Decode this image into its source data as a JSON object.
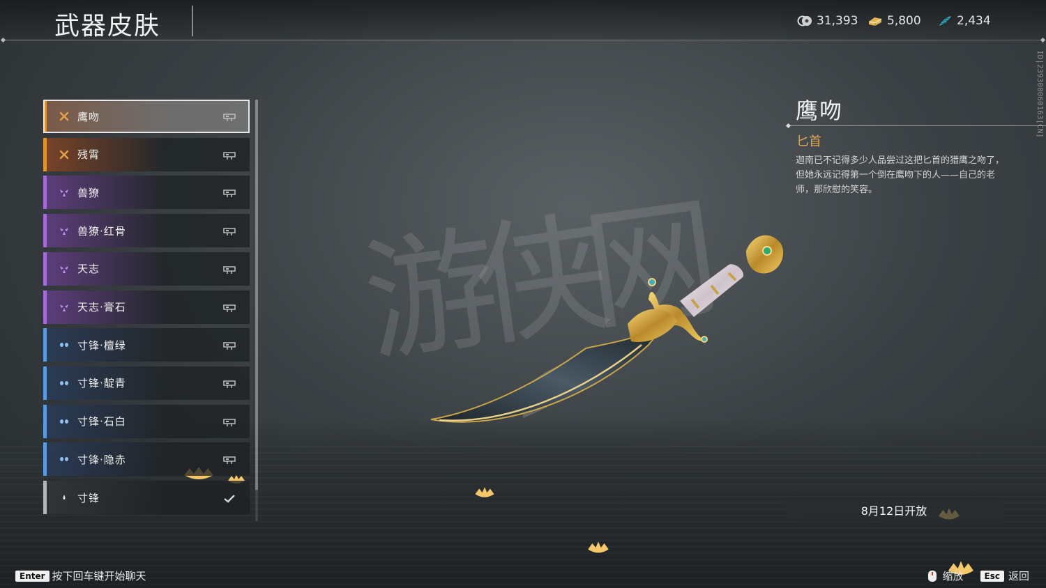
{
  "header": {
    "title": "武器皮肤",
    "currencies": [
      {
        "icon": "coin-pile-icon",
        "value": "31,393"
      },
      {
        "icon": "gold-ingot-icon",
        "value": "5,800"
      },
      {
        "icon": "jade-feather-icon",
        "value": "2,434"
      }
    ]
  },
  "side_id": "ID|239300060163[CN]",
  "skins": [
    {
      "label": "鹰吻",
      "rarity": "orange",
      "icon": "rarity-star-icon",
      "selected": true
    },
    {
      "label": "残霄",
      "rarity": "orange",
      "icon": "rarity-star-icon"
    },
    {
      "label": "兽獠",
      "rarity": "purple",
      "icon": "rarity-triangle-icon"
    },
    {
      "label": "兽獠·红骨",
      "rarity": "purple",
      "icon": "rarity-triangle-icon"
    },
    {
      "label": "天志",
      "rarity": "purple",
      "icon": "rarity-triangle-icon"
    },
    {
      "label": "天志·膏石",
      "rarity": "purple",
      "icon": "rarity-triangle-icon"
    },
    {
      "label": "寸锋·檀绿",
      "rarity": "blue",
      "icon": "rarity-dots-icon"
    },
    {
      "label": "寸锋·靛青",
      "rarity": "blue",
      "icon": "rarity-dots-icon"
    },
    {
      "label": "寸锋·石白",
      "rarity": "blue",
      "icon": "rarity-dots-icon"
    },
    {
      "label": "寸锋·隐赤",
      "rarity": "blue",
      "icon": "rarity-dots-icon"
    },
    {
      "label": "寸锋",
      "rarity": "gray",
      "icon": "rarity-drop-icon",
      "equipped": true
    }
  ],
  "detail": {
    "name": "鹰吻",
    "type": "匕首",
    "description": "迦南已不记得多少人品尝过这把匕首的猎鹰之吻了，但她永远记得第一个倒在鹰吻下的人——自己的老师，那欣慰的笑容。"
  },
  "release_text": "8月12日开放",
  "footer": {
    "enter_key": "Enter",
    "chat_hint": "按下回车键开始聊天",
    "zoom_label": "缩放",
    "esc_key": "Esc",
    "back_label": "返回"
  },
  "colors": {
    "orange": "#e0922c",
    "purple": "#a46ad6",
    "blue": "#5c9ae0",
    "gray": "#b5b5b5",
    "type_gold": "#e0a858"
  }
}
